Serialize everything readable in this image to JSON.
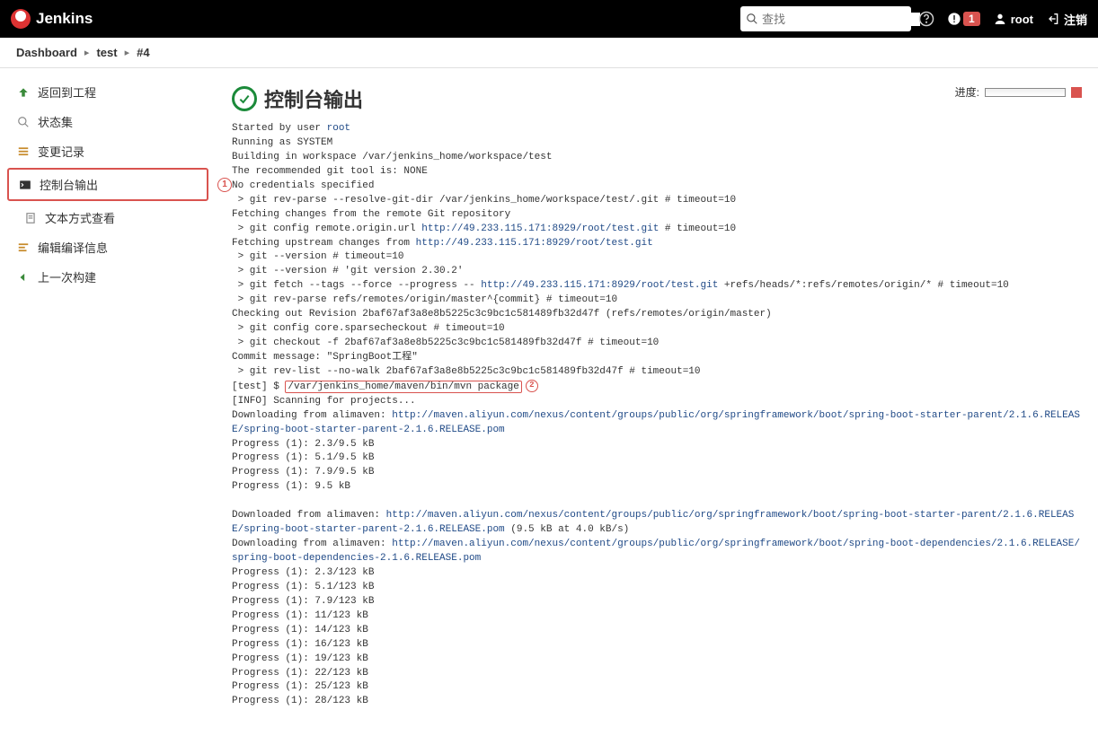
{
  "header": {
    "brand": "Jenkins",
    "search_placeholder": "查找",
    "alert_count": "1",
    "username": "root",
    "logout_label": "注销"
  },
  "breadcrumb": {
    "items": [
      "Dashboard",
      "test",
      "#4"
    ]
  },
  "sidebar": {
    "items": [
      {
        "label": "返回到工程"
      },
      {
        "label": "状态集"
      },
      {
        "label": "变更记录"
      },
      {
        "label": "控制台输出"
      },
      {
        "label": "文本方式查看"
      },
      {
        "label": "编辑编译信息"
      },
      {
        "label": "上一次构建"
      }
    ]
  },
  "annotations": {
    "sidebar_num": "1",
    "console_num": "2"
  },
  "main": {
    "progress_label": "进度:",
    "title": "控制台输出",
    "console": {
      "l1_pre": "Started by user ",
      "l1_link": "root",
      "l2": "Running as SYSTEM",
      "l3": "Building in workspace /var/jenkins_home/workspace/test",
      "l4": "The recommended git tool is: NONE",
      "l5": "No credentials specified",
      "l6": " > git rev-parse --resolve-git-dir /var/jenkins_home/workspace/test/.git # timeout=10",
      "l7": "Fetching changes from the remote Git repository",
      "l8_pre": " > git config remote.origin.url ",
      "l8_link": "http://49.233.115.171:8929/root/test.git",
      "l8_post": " # timeout=10",
      "l9_pre": "Fetching upstream changes from ",
      "l9_link": "http://49.233.115.171:8929/root/test.git",
      "l10": " > git --version # timeout=10",
      "l11": " > git --version # 'git version 2.30.2'",
      "l12_pre": " > git fetch --tags --force --progress -- ",
      "l12_link": "http://49.233.115.171:8929/root/test.git",
      "l12_post": " +refs/heads/*:refs/remotes/origin/* # timeout=10",
      "l13": " > git rev-parse refs/remotes/origin/master^{commit} # timeout=10",
      "l14": "Checking out Revision 2baf67af3a8e8b5225c3c9bc1c581489fb32d47f (refs/remotes/origin/master)",
      "l15": " > git config core.sparsecheckout # timeout=10",
      "l16": " > git checkout -f 2baf67af3a8e8b5225c3c9bc1c581489fb32d47f # timeout=10",
      "l17": "Commit message: \"SpringBoot工程\"",
      "l18": " > git rev-list --no-walk 2baf67af3a8e8b5225c3c9bc1c581489fb32d47f # timeout=10",
      "l19_pre": "[test] $ ",
      "l19_box": "/var/jenkins_home/maven/bin/mvn package",
      "l20": "[INFO] Scanning for projects...",
      "l21_pre": "Downloading from alimaven: ",
      "l21_link": "http://maven.aliyun.com/nexus/content/groups/public/org/springframework/boot/spring-boot-starter-parent/2.1.6.RELEASE/spring-boot-starter-parent-2.1.6.RELEASE.pom",
      "l22": "Progress (1): 2.3/9.5 kB",
      "l23": "Progress (1): 5.1/9.5 kB",
      "l24": "Progress (1): 7.9/9.5 kB",
      "l25": "Progress (1): 9.5 kB",
      "blank": " ",
      "l26_pre": "Downloaded from alimaven: ",
      "l26_link": "http://maven.aliyun.com/nexus/content/groups/public/org/springframework/boot/spring-boot-starter-parent/2.1.6.RELEASE/spring-boot-starter-parent-2.1.6.RELEASE.pom",
      "l26_post": " (9.5 kB at 4.0 kB/s)",
      "l27_pre": "Downloading from alimaven: ",
      "l27_link": "http://maven.aliyun.com/nexus/content/groups/public/org/springframework/boot/spring-boot-dependencies/2.1.6.RELEASE/spring-boot-dependencies-2.1.6.RELEASE.pom",
      "l28": "Progress (1): 2.3/123 kB",
      "l29": "Progress (1): 5.1/123 kB",
      "l30": "Progress (1): 7.9/123 kB",
      "l31": "Progress (1): 11/123 kB",
      "l32": "Progress (1): 14/123 kB",
      "l33": "Progress (1): 16/123 kB",
      "l34": "Progress (1): 19/123 kB",
      "l35": "Progress (1): 22/123 kB",
      "l36": "Progress (1): 25/123 kB",
      "l37": "Progress (1): 28/123 kB"
    }
  }
}
